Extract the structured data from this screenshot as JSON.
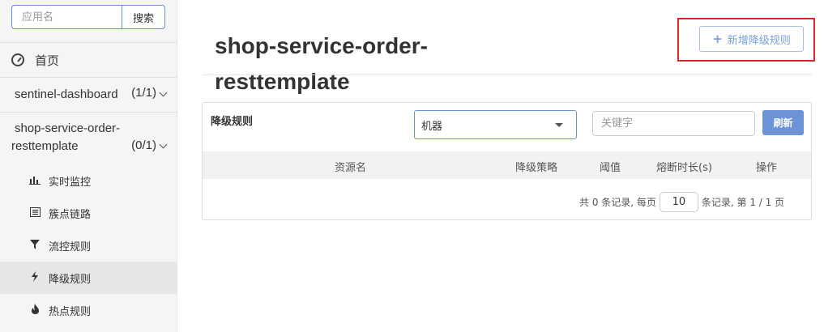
{
  "sidebar": {
    "search": {
      "placeholder": "应用名",
      "button_label": "搜索"
    },
    "home_label": "首页",
    "apps": [
      {
        "name": "sentinel-dashboard",
        "count": "(1/1)"
      },
      {
        "name_line1": "shop-service-order-",
        "name_line2": "resttemplate",
        "count": "(0/1)"
      }
    ],
    "sub_items": [
      {
        "label": "实时监控",
        "icon": "bar-chart-icon"
      },
      {
        "label": "簇点链路",
        "icon": "list-icon"
      },
      {
        "label": "流控规则",
        "icon": "filter-icon"
      },
      {
        "label": "降级规则",
        "icon": "flash-icon",
        "active": true
      },
      {
        "label": "热点规则",
        "icon": "fire-icon"
      }
    ]
  },
  "main": {
    "title_line1": "shop-service-order-",
    "title_line2": "resttemplate",
    "add_button_label": "新增降级规则",
    "panel": {
      "title": "降级规则",
      "machine_select": "机器",
      "keyword_placeholder": "关键字",
      "refresh_label": "刷新",
      "columns": [
        "资源名",
        "降级策略",
        "阈值",
        "熔断时长(s)",
        "操作"
      ],
      "rows": [],
      "pagination": {
        "prefix": "共 0 条记录, 每页",
        "page_size": "10",
        "suffix": "条记录, 第 1 / 1 页"
      }
    }
  },
  "colors": {
    "accent": "#6b93d6",
    "highlight_border": "#d9262c",
    "sidebar_bg": "#f5f5f5",
    "active_item_bg": "#e6e6e6"
  }
}
